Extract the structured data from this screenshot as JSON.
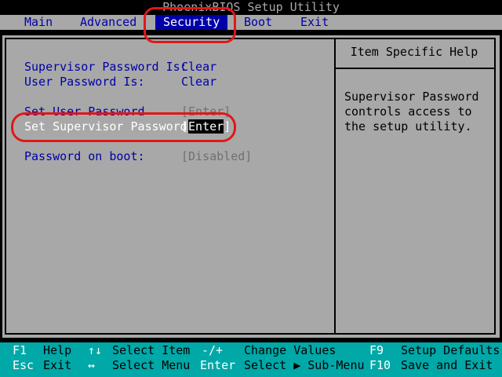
{
  "title": "PhoenixBIOS Setup Utility",
  "menu": {
    "tabs": [
      "Main",
      "Advanced",
      "Security",
      "Boot",
      "Exit"
    ],
    "active": "Security"
  },
  "fields": {
    "supervisor_status_label": "Supervisor Password Is:",
    "supervisor_status_value": "Clear",
    "user_status_label": "User Password Is:",
    "user_status_value": "Clear",
    "set_user_label": "Set User Password",
    "set_user_value": "[Enter]",
    "set_supervisor_label": "Set Supervisor Password",
    "set_supervisor_value": "Enter",
    "password_on_boot_label": "Password on boot:",
    "password_on_boot_value": "[Disabled]"
  },
  "help": {
    "title": "Item Specific Help",
    "text": "Supervisor Password controls access to the setup utility."
  },
  "footer": {
    "row1": [
      {
        "key": "F1",
        "desc": "Help"
      },
      {
        "key": "↑↓",
        "desc": "Select Item"
      },
      {
        "key": "-/+",
        "desc": "Change Values"
      },
      {
        "key": "F9",
        "desc": "Setup Defaults"
      }
    ],
    "row2": [
      {
        "key": "Esc",
        "desc": "Exit"
      },
      {
        "key": "↔",
        "desc": "Select Menu"
      },
      {
        "key": "Enter",
        "desc": "Select ▶ Sub-Menu"
      },
      {
        "key": "F10",
        "desc": "Save and Exit"
      }
    ]
  },
  "colors": {
    "panel": "#a8a8a8",
    "menu_text": "#0000a8",
    "active_tab": "#0000a8",
    "footer": "#00a8a8",
    "annotation": "#e01818"
  }
}
